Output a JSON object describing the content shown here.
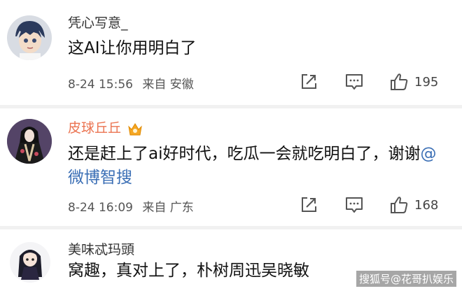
{
  "comments": [
    {
      "username": "凭心写意_",
      "text": "这AI让你用明白了",
      "date": "8-24 15:56",
      "source": "来自 安徽",
      "likes": "195",
      "avatar_icon": "anime-boy-avatar-icon"
    },
    {
      "username": "皮球丘丘",
      "text_main": "还是赶上了ai好时代，吃瓜一会就吃明白了，谢谢",
      "mention": "@微博智搜",
      "date": "8-24 16:09",
      "source": "来自 广东",
      "likes": "168",
      "avatar_icon": "kimono-girl-avatar-icon",
      "badge_icon": "vip-crown-icon"
    },
    {
      "username": "美味忒玛頭",
      "text": "窝趣，真对上了，朴树周迅吴晓敏",
      "avatar_icon": "chibi-girl-avatar-icon"
    }
  ],
  "watermark": "搜狐号@花哥扒娱乐",
  "colors": {
    "username_highlight": "#eb7350",
    "mention": "#3b6fb5",
    "separator": "#f1f1f1"
  }
}
